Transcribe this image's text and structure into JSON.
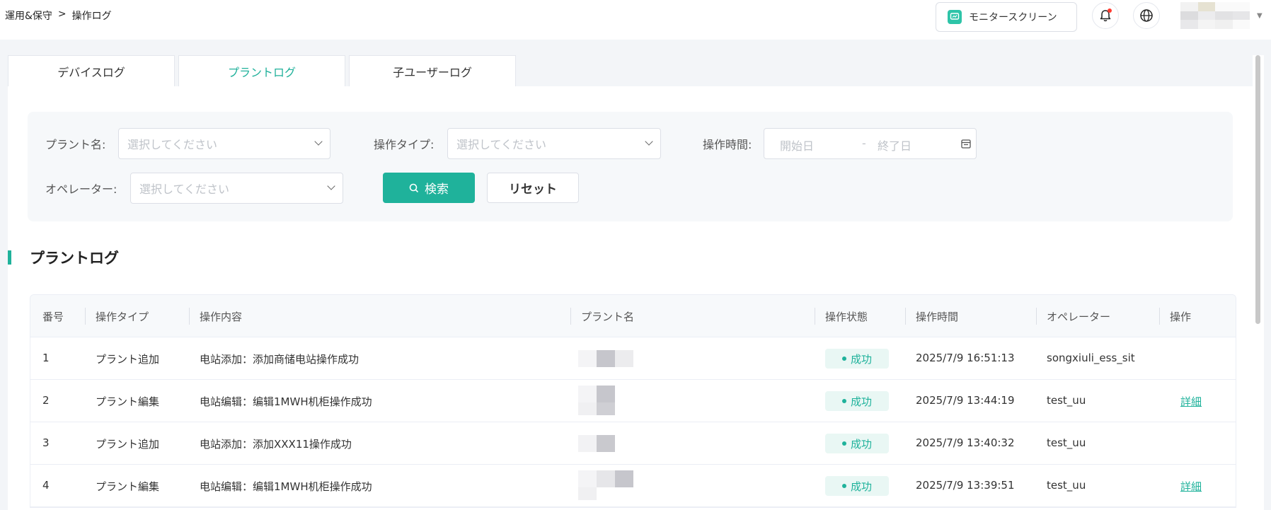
{
  "breadcrumb": {
    "parent": "運用&保守",
    "separator": ">",
    "current": "操作ログ"
  },
  "header": {
    "monitor_label": "モニタースクリーン"
  },
  "tabs": [
    {
      "label": "デバイスログ"
    },
    {
      "label": "プラントログ"
    },
    {
      "label": "子ユーザーログ"
    }
  ],
  "filters": {
    "plant_label": "プラント名:",
    "plant_placeholder": "選択してください",
    "type_label": "操作タイプ:",
    "type_placeholder": "選択してください",
    "time_label": "操作時間:",
    "start_placeholder": "開始日",
    "range_separator": "-",
    "end_placeholder": "終了日",
    "operator_label": "オペレーター:",
    "operator_placeholder": "選択してください",
    "search_label": "検索",
    "reset_label": "リセット"
  },
  "section_title": "プラントログ",
  "table": {
    "columns": [
      "番号",
      "操作タイプ",
      "操作内容",
      "プラント名",
      "操作状態",
      "操作時間",
      "オペレーター",
      "操作"
    ],
    "rows": [
      {
        "no": "1",
        "type": "プラント追加",
        "content": "电站添加：添加商储电站操作成功",
        "status": "成功",
        "time": "2025/7/9 16:51:13",
        "operator": "songxiuli_ess_sit",
        "action": ""
      },
      {
        "no": "2",
        "type": "プラント編集",
        "content": "电站编辑：编辑1MWH机柜操作成功",
        "status": "成功",
        "time": "2025/7/9 13:44:19",
        "operator": "test_uu",
        "action": "詳細"
      },
      {
        "no": "3",
        "type": "プラント追加",
        "content": "电站添加：添加XXX11操作成功",
        "status": "成功",
        "time": "2025/7/9 13:40:32",
        "operator": "test_uu",
        "action": ""
      },
      {
        "no": "4",
        "type": "プラント編集",
        "content": "电站编辑：编辑1MWH机柜操作成功",
        "status": "成功",
        "time": "2025/7/9 13:39:51",
        "operator": "test_uu",
        "action": "詳細"
      }
    ]
  },
  "colors": {
    "accent": "#1fb29b",
    "status_bg": "#e9f7f4",
    "notification_dot": "#ff3b30"
  },
  "icons": [
    "monitor-icon",
    "bell-icon",
    "globe-icon",
    "avatar-image",
    "chevron-down-icon",
    "search-icon",
    "calendar-icon"
  ]
}
